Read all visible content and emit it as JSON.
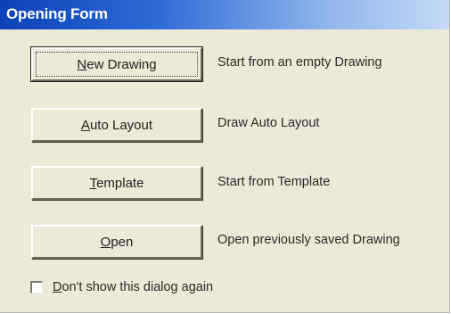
{
  "window": {
    "title": "Opening Form"
  },
  "options": [
    {
      "button_label": "New Drawing",
      "mnemonic": "N",
      "rest": "ew Drawing",
      "description": "Start from an empty  Drawing"
    },
    {
      "button_label": "Auto Layout",
      "mnemonic": "A",
      "rest": "uto Layout",
      "description": "Draw Auto Layout"
    },
    {
      "button_label": "Template",
      "mnemonic": "T",
      "rest": "emplate",
      "description": "Start from Template"
    },
    {
      "button_label": "Open",
      "mnemonic": "O",
      "rest": "pen",
      "description": "Open previously saved Drawing"
    }
  ],
  "dont_show_checkbox": {
    "mnemonic": "D",
    "rest": "on't show this dialog again",
    "label": "Don't show this dialog again",
    "checked": false
  },
  "colors": {
    "titlebar_start": "#0a42b8",
    "titlebar_end": "#c4daf6",
    "dialog_face": "#ece9d8"
  }
}
